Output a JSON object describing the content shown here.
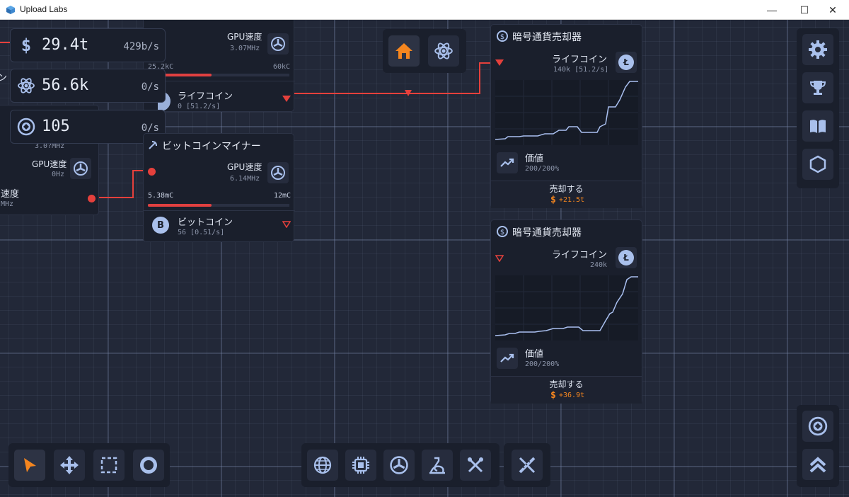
{
  "window": {
    "title": "Upload Labs",
    "minimize": "—",
    "maximize": "☐",
    "close": "✕"
  },
  "resources": [
    {
      "icon": "dollar-icon",
      "value": "29.4t",
      "rate": "429b/s"
    },
    {
      "icon": "atom-icon",
      "value": "56.6k",
      "rate": "0/s"
    },
    {
      "icon": "token-icon",
      "value": "105",
      "rate": "0/s"
    }
  ],
  "left_node": {
    "gpu_label": "GPU速度",
    "gpu_value": "0Hz",
    "partial_label": "速度",
    "partial_value": "MHz",
    "partial_top_char": "ン",
    "partial_mid": "3.0?MHz"
  },
  "top_miner": {
    "gpu_label": "GPU速度",
    "gpu_value": "3.07MHz",
    "min": "25.2kC",
    "max": "60kC",
    "progress": 0.42,
    "coin_name": "ライフコイン",
    "coin_value": "0 [51.2/s]"
  },
  "bitcoin_miner": {
    "title": "ビットコインマイナー",
    "gpu_label": "GPU速度",
    "gpu_value": "6.14MHz",
    "min": "5.38mC",
    "max": "12mC",
    "progress": 0.45,
    "coin_name": "ビットコイン",
    "coin_value": "56 [0.51/s]"
  },
  "seller1": {
    "title": "暗号通貨売却器",
    "coin_name": "ライフコイン",
    "coin_value": "140k [51.2/s]",
    "value_label": "価値",
    "value_pct": "200/200%",
    "sell_label": "売却する",
    "sell_amount": "+21.5t"
  },
  "seller2": {
    "title": "暗号通貨売却器",
    "coin_name": "ライフコイン",
    "coin_value": "240k",
    "value_label": "価値",
    "value_pct": "200/200%",
    "sell_label": "売却する",
    "sell_amount": "+36.9t"
  },
  "top_nav": [
    "home-icon",
    "atom-icon"
  ],
  "right_menu": [
    "gear-icon",
    "trophy-icon",
    "book-icon",
    "hexagon-icon"
  ],
  "right_bottom": [
    "token-icon",
    "chevrons-up-icon"
  ],
  "tools": [
    "cursor-icon",
    "move-icon",
    "select-icon",
    "circle-icon"
  ],
  "bottom_bar": [
    "globe-icon",
    "cpu-icon",
    "gpu-fan-icon",
    "research-icon",
    "tools-icon",
    "ruler-pencil-icon"
  ],
  "colors": {
    "accent": "#f5861f",
    "wire": "#e5403c",
    "icon": "#a9c0ec",
    "chart_line": "#aac0f0"
  }
}
